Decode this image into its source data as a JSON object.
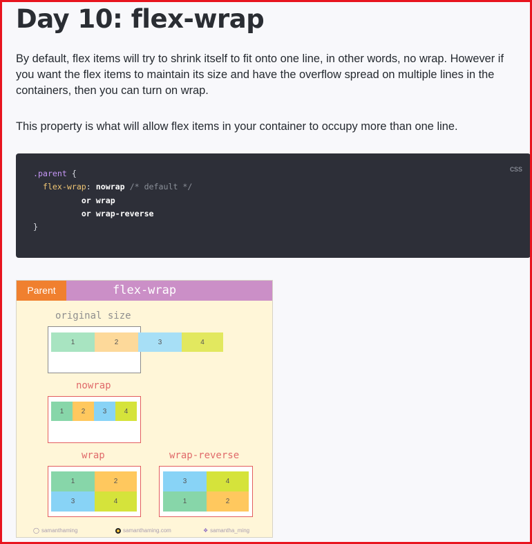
{
  "title": "Day 10: flex-wrap",
  "paragraph1": "By default, flex items will try to shrink itself to fit onto one line, in other words, no wrap. However if you want the flex items to maintain its size and have the overflow spread on multiple lines in the containers, then you can turn on wrap.",
  "paragraph2": "This property is what will allow flex items in your container to occupy more than one line.",
  "code": {
    "language": "css",
    "selector": ".parent",
    "open_brace": "{",
    "property": "flex-wrap",
    "value_default": "nowrap",
    "comment": "/* default */",
    "or1": "or",
    "value_wrap": "wrap",
    "or2": "or",
    "value_wrap_reverse": "wrap-reverse",
    "close_brace": "}"
  },
  "illustration": {
    "header_parent": "Parent",
    "header_title": "flex-wrap",
    "original_label": "original size",
    "nowrap_label": "nowrap",
    "wrap_label": "wrap",
    "wrap_reverse_label": "wrap-reverse",
    "items": [
      "1",
      "2",
      "3",
      "4"
    ],
    "wrap_reverse_order": [
      "3",
      "4",
      "1",
      "2"
    ],
    "colors": {
      "item1": "#87d6a9",
      "item2": "#ffc85e",
      "item3": "#88d3f6",
      "item4": "#d5e33b",
      "header_parent": "#f0802f",
      "header_title": "#cb8fc7",
      "background": "#fff6d8"
    },
    "footer": {
      "instagram": "samanthaming",
      "website": "samanthaming.com",
      "twitter": "samantha_ming"
    }
  }
}
